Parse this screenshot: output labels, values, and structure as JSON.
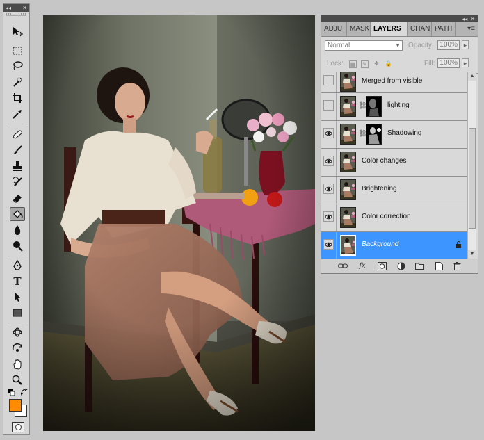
{
  "tools_panel": {
    "collapse_glyph": "◂◂",
    "close_glyph": "✕",
    "tool_icons": [
      "move-icon",
      "marquee-icon",
      "lasso-icon",
      "quick-selection-icon",
      "crop-icon",
      "eyedropper-icon",
      "spot-healing-icon",
      "brush-icon",
      "clone-stamp-icon",
      "history-brush-icon",
      "eraser-icon",
      "paint-bucket-icon",
      "blur-icon",
      "dodge-icon",
      "pen-icon",
      "type-icon",
      "path-selection-icon",
      "rectangle-icon",
      "3d-rotate-icon",
      "3d-orbit-icon",
      "hand-icon",
      "zoom-icon"
    ],
    "active_tool": "paint-bucket-icon",
    "type_glyph": "T",
    "foreground_color": "#ff8c00",
    "background_color": "#ffffff"
  },
  "layers_panel": {
    "collapse_glyph": "◂◂",
    "close_glyph": "✕",
    "tabs": [
      {
        "label": "ADJU"
      },
      {
        "label": "MASK"
      },
      {
        "label": "LAYERS"
      },
      {
        "label": "CHAN"
      },
      {
        "label": "PATH"
      }
    ],
    "active_tab": "LAYERS",
    "menu_glyph": "▾≡",
    "blend_mode": "Normal",
    "opacity_label": "Opacity:",
    "opacity_value": "100%",
    "lock_label": "Lock:",
    "fill_label": "Fill:",
    "fill_value": "100%",
    "layers": [
      {
        "name": "Merged from visible",
        "visible": false,
        "has_mask": false,
        "selected": false
      },
      {
        "name": "lighting",
        "visible": false,
        "has_mask": true,
        "selected": false
      },
      {
        "name": "Shadowing",
        "visible": true,
        "has_mask": true,
        "selected": false
      },
      {
        "name": "Color changes",
        "visible": true,
        "has_mask": false,
        "selected": false
      },
      {
        "name": "Brightening",
        "visible": true,
        "has_mask": false,
        "selected": false
      },
      {
        "name": "Color correction",
        "visible": true,
        "has_mask": false,
        "selected": false
      },
      {
        "name": "Background",
        "visible": true,
        "has_mask": false,
        "selected": true,
        "locked": true
      }
    ],
    "selection_color": "#3d96ff",
    "footer_icons": [
      "link-layers-icon",
      "fx-icon",
      "add-mask-icon",
      "adjustment-layer-icon",
      "new-group-icon",
      "new-layer-icon",
      "trash-icon"
    ],
    "fx_glyph": "fx"
  }
}
